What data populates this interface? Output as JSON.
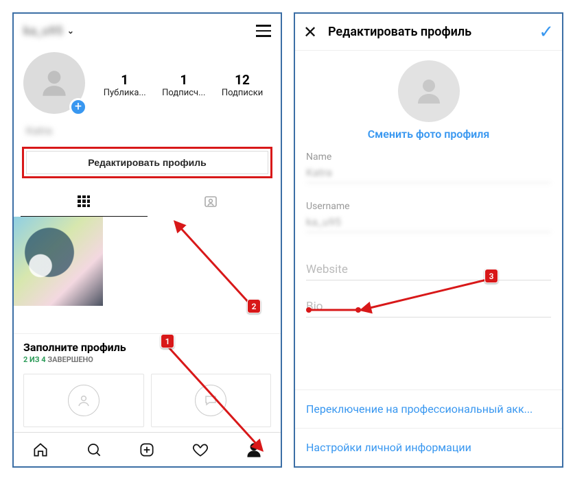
{
  "left": {
    "username": "ka_u95",
    "stats": {
      "posts": {
        "count": "1",
        "label": "Публика..."
      },
      "followers": {
        "count": "1",
        "label": "Подписч..."
      },
      "following": {
        "count": "12",
        "label": "Подписки"
      }
    },
    "displayName": "Katra",
    "editProfile": "Редактировать профиль",
    "fillTitle": "Заполните профиль",
    "fillDone": "2 ИЗ 4",
    "fillRest": " ЗАВЕРШЕНО"
  },
  "right": {
    "title": "Редактировать профиль",
    "changePhoto": "Сменить фото профиля",
    "nameLabel": "Name",
    "nameValue": "Katra",
    "usernameLabel": "Username",
    "usernameValue": "ka_u95",
    "websitePlaceholder": "Website",
    "bioPlaceholder": "Bio",
    "switchPro": "Переключение на профессиональный акк...",
    "personalInfo": "Настройки личной информации"
  },
  "badges": {
    "b1": "1",
    "b2": "2",
    "b3": "3"
  }
}
